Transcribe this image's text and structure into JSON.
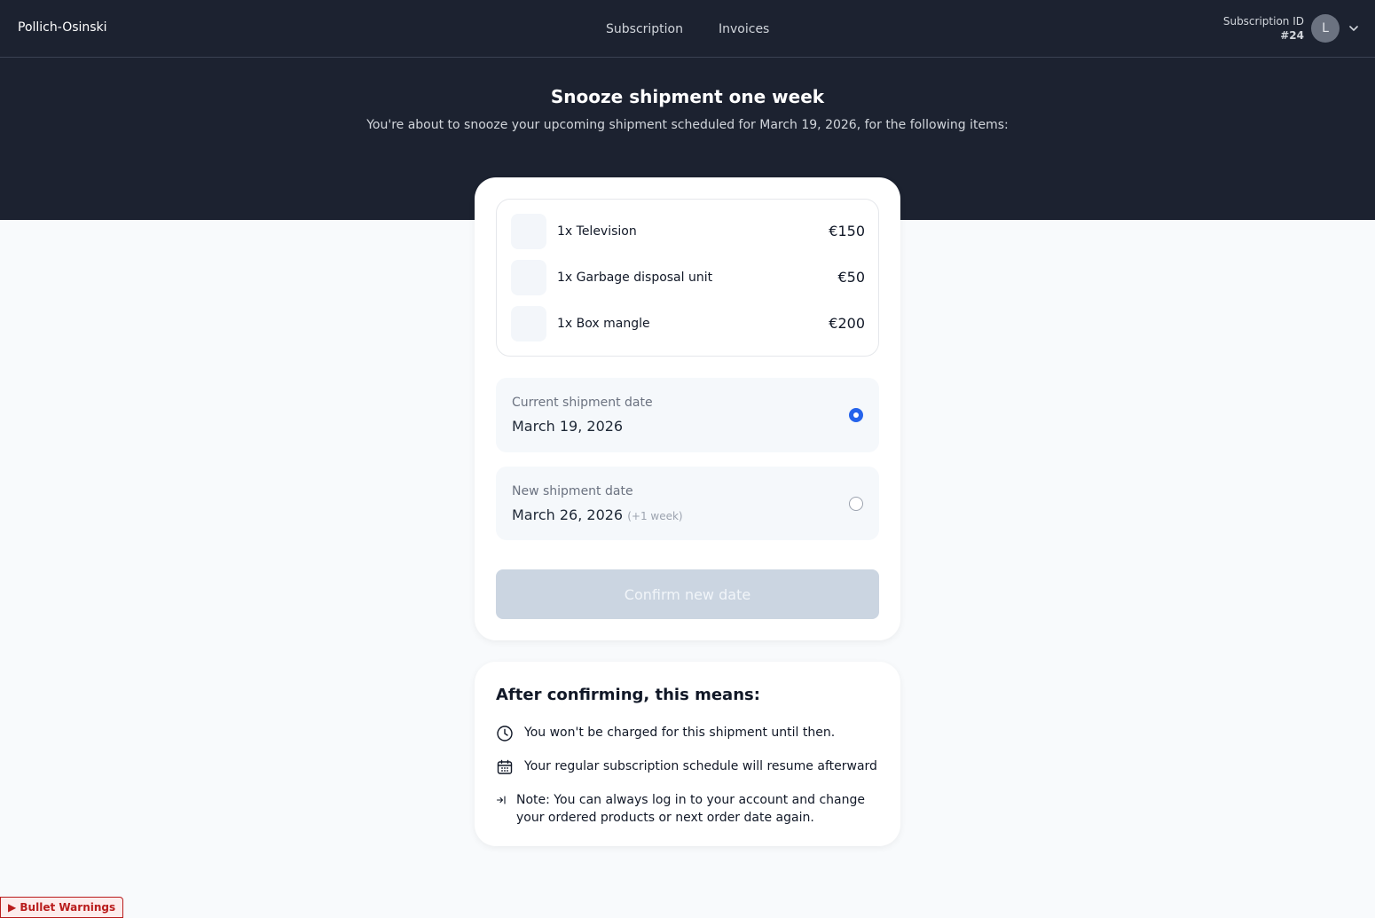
{
  "header": {
    "brand": "Pollich-Osinski",
    "nav": [
      {
        "label": "Subscription"
      },
      {
        "label": "Invoices"
      }
    ],
    "subscription_id_label": "Subscription ID",
    "subscription_id_value": "#24",
    "avatar_initial": "L",
    "icons": {
      "dropdown": "chevron-down-icon"
    }
  },
  "hero": {
    "title": "Snooze shipment one week",
    "subtitle": "You're about to snooze your upcoming shipment scheduled for March 19, 2026, for the following items:"
  },
  "items": [
    {
      "name": "1x Television",
      "price": "€150"
    },
    {
      "name": "1x Garbage disposal unit",
      "price": "€50"
    },
    {
      "name": "1x Box mangle",
      "price": "€200"
    }
  ],
  "dates": {
    "current": {
      "label": "Current shipment date",
      "value": "March 19, 2026",
      "selected": true
    },
    "new": {
      "label": "New shipment date",
      "value": "March 26, 2026",
      "extra": "(+1 week)",
      "selected": false
    }
  },
  "confirm_label": "Confirm new date",
  "info": {
    "title": "After confirming, this means:",
    "points": [
      {
        "icon": "clock-icon",
        "text": "You won't be charged for this shipment until then."
      },
      {
        "icon": "calendar-icon",
        "text": "Your regular subscription schedule will resume afterward"
      },
      {
        "icon": "arrow-into-icon",
        "text": "Note: You can always log in to your account and change your ordered products or next order date again."
      }
    ]
  },
  "debug_toggle": "▶ Bullet Warnings",
  "colors": {
    "header_bg": "#1c2230",
    "accent": "#2563eb",
    "disabled_button": "#cbd5e1",
    "warning": "#b91c1c"
  }
}
